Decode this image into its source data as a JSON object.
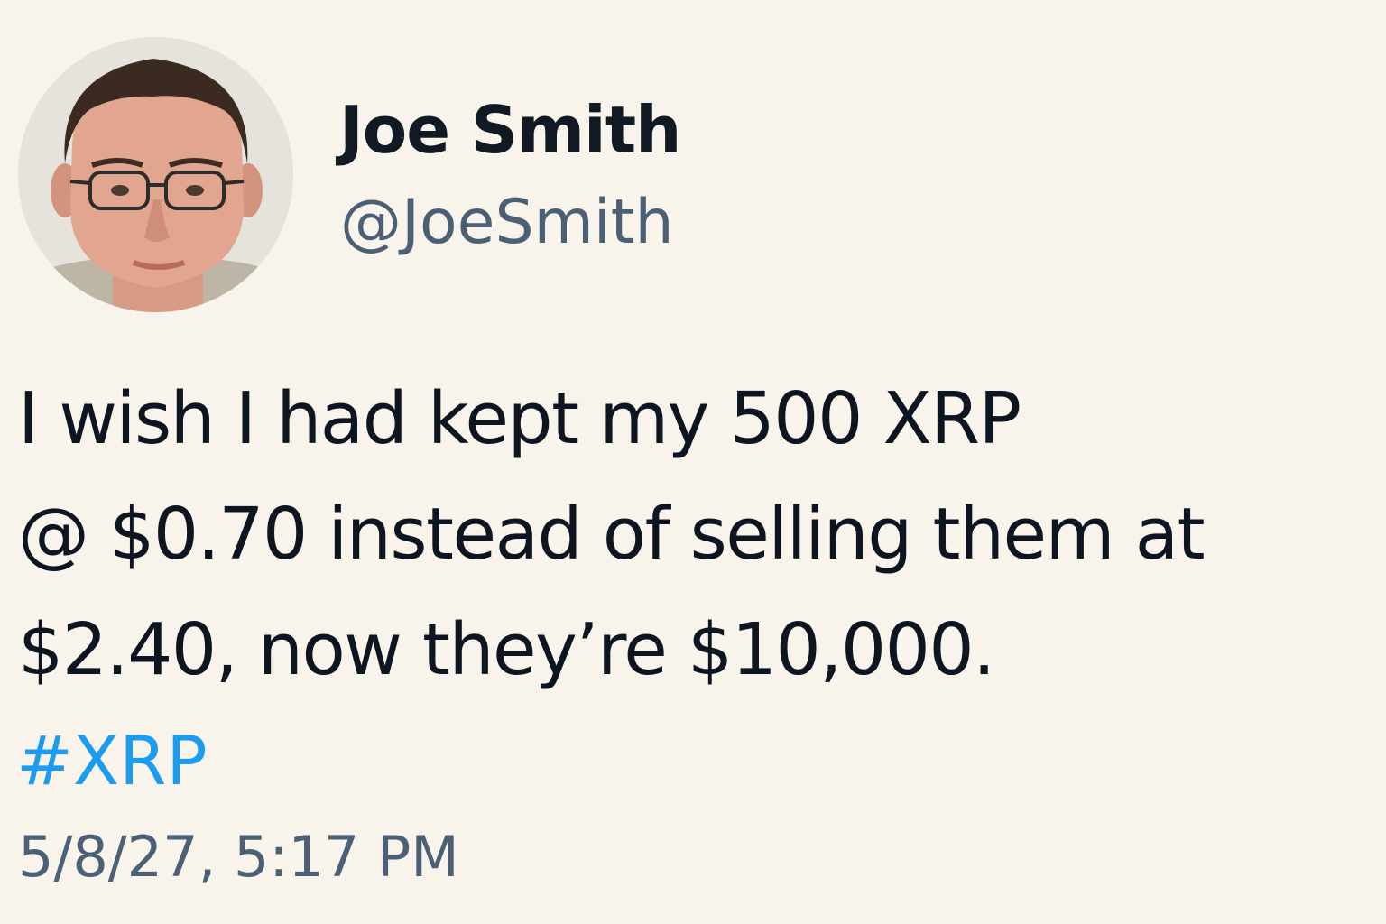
{
  "author": {
    "display_name": "Joe Smith",
    "handle": "@JoeSmith",
    "avatar_icon": "profile-photo"
  },
  "tweet": {
    "text_lines": [
      "I wish I had kept my 500 XRP",
      "@ $0.70 instead of selling them at",
      "$2.40, now they’re $10,000."
    ],
    "hashtag": "#XRP",
    "timestamp": "5/8/27, 5:17 PM"
  },
  "colors": {
    "background": "#f8f3eb",
    "name": "#111a22",
    "handle": "#4b6075",
    "body": "#0d1620",
    "hashtag": "#1c9cef",
    "timestamp": "#4b6075"
  }
}
